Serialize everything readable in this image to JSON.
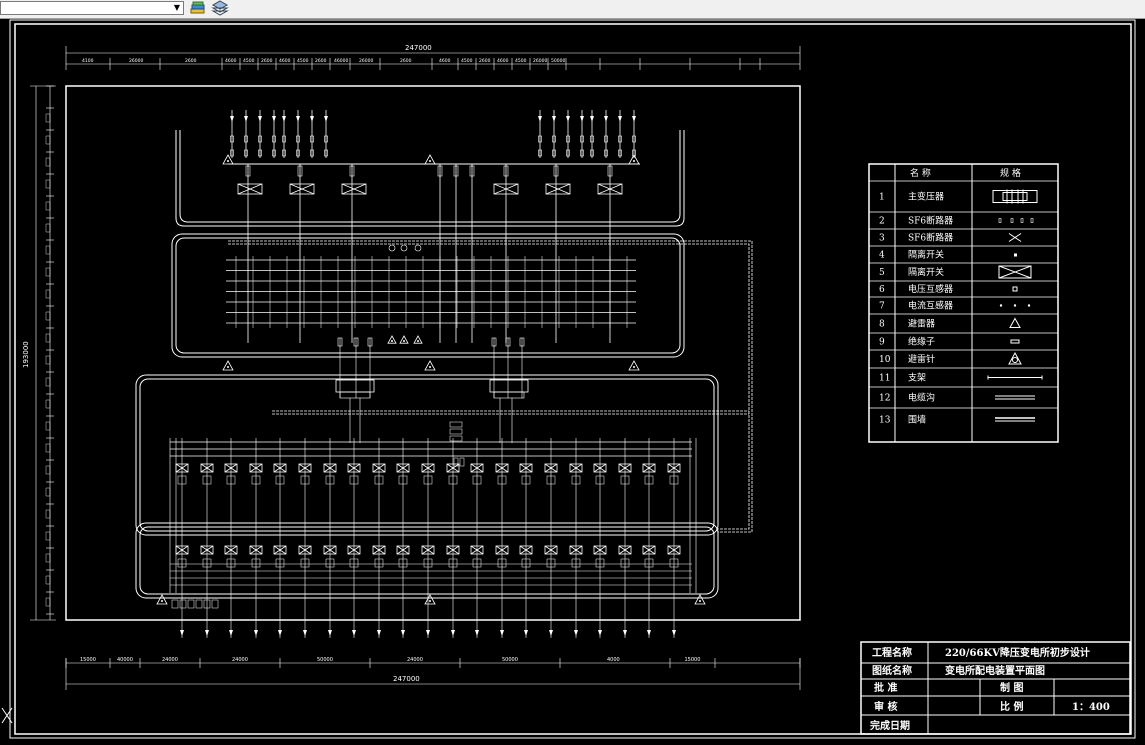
{
  "toolbar": {
    "layer_combo_value": "",
    "icons": [
      "layer-states-icon",
      "layer-stack-icon"
    ]
  },
  "drawing": {
    "overall_width_label": "247000",
    "overall_height_label": "193000",
    "top_dims": [
      "4100",
      "26000",
      "2600",
      "4600",
      "4500",
      "2600",
      "4600",
      "4500",
      "2600",
      "46000",
      "26000",
      "2600",
      "4600",
      "4500",
      "2600",
      "4600",
      "4500",
      "26000",
      "50000"
    ],
    "bottom_dims": [
      "15000",
      "40000",
      "24000",
      "24000",
      "50000",
      "24000",
      "50000",
      "4000",
      "15000"
    ]
  },
  "legend": {
    "header_col1": "名 称",
    "header_col2": "规 格",
    "rows": [
      {
        "no": "1",
        "name": "主变压器",
        "symbol": "transformer-symbol"
      },
      {
        "no": "2",
        "name": "SF6断路器",
        "symbol": "breaker-dots-symbol"
      },
      {
        "no": "3",
        "name": "SF6断路器",
        "symbol": "breaker-x-symbol"
      },
      {
        "no": "4",
        "name": "隔离开关",
        "symbol": "dot-symbol"
      },
      {
        "no": "5",
        "name": "隔离开关",
        "symbol": "boxed-x-symbol"
      },
      {
        "no": "6",
        "name": "电压互感器",
        "symbol": "small-square-symbol"
      },
      {
        "no": "7",
        "name": "电流互感器",
        "symbol": "three-dots-symbol"
      },
      {
        "no": "8",
        "name": "避雷器",
        "symbol": "arrester-triangle-symbol"
      },
      {
        "no": "9",
        "name": "绝缘子",
        "symbol": "insulator-symbol"
      },
      {
        "no": "10",
        "name": "避雷针",
        "symbol": "lightning-rod-symbol"
      },
      {
        "no": "11",
        "name": "支架",
        "symbol": "line-symbol"
      },
      {
        "no": "12",
        "name": "电缆沟",
        "symbol": "double-line-symbol"
      },
      {
        "no": "13",
        "name": "围墙",
        "symbol": "wall-symbol"
      }
    ]
  },
  "title_block": {
    "project_label": "工程名称",
    "project_value": "220/66KV降压变电所初步设计",
    "drawing_label": "图纸名称",
    "drawing_value": "变电所配电装置平面图",
    "approve_label": "批 准",
    "drawn_label": "制 图",
    "review_label": "审 核",
    "scale_label": "比 例",
    "scale_value": "1：400",
    "date_label": "完成日期"
  }
}
